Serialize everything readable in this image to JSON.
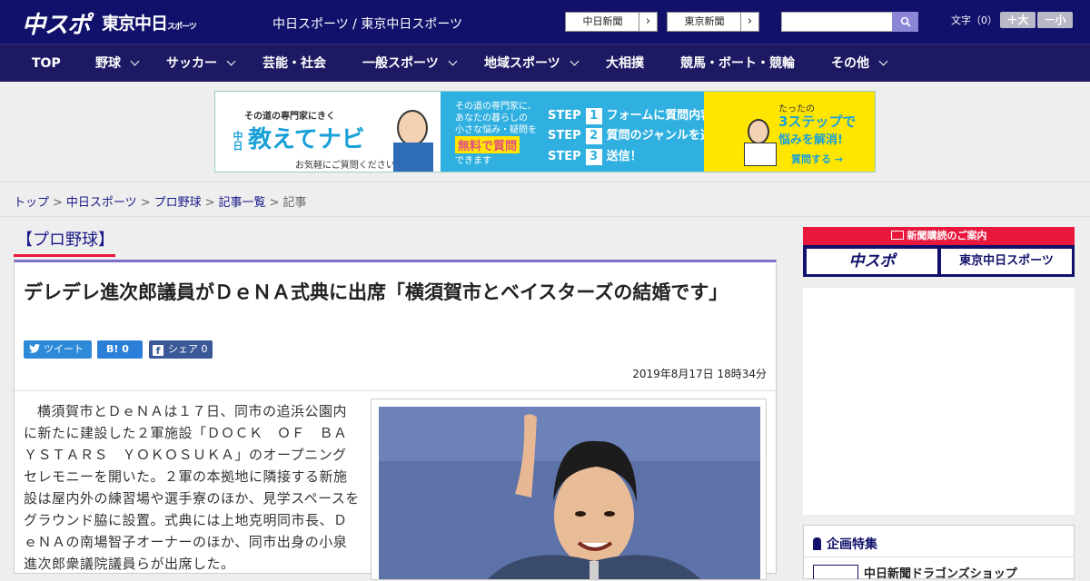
{
  "header": {
    "logo_chuspo": "中スポ",
    "logo_tokyo": "東京中日",
    "logo_tokyo_sub": "スポーツ",
    "site_title": "中日スポーツ / 東京中日スポーツ",
    "ext_links": [
      {
        "label": "中日新聞",
        "arrow": "›"
      },
      {
        "label": "東京新聞",
        "arrow": "›"
      }
    ],
    "search_placeholder": "",
    "font_size_label": "文字（0）",
    "font_larger": "＋大",
    "font_smaller": "－小"
  },
  "nav": {
    "items": [
      {
        "label": "TOP"
      },
      {
        "label": "野球"
      },
      {
        "label": "サッカー"
      },
      {
        "label": "芸能・社会"
      },
      {
        "label": "一般スポーツ"
      },
      {
        "label": "地域スポーツ"
      },
      {
        "label": "大相撲"
      },
      {
        "label": "競馬・ボート・競輪"
      },
      {
        "label": "その他"
      }
    ]
  },
  "ad_banner": {
    "tagline": "その道の専門家にきく",
    "brand_prefix": "中日",
    "brand": "教えてナビ",
    "note": "お気軽にご質問ください!",
    "mid_line1": "その道の専門家に、",
    "mid_line2": "あなたの暮らしの",
    "mid_line3": "小さな悩み・疑問を",
    "mid_badge": "無料で質問",
    "mid_line4": "できます",
    "steps": [
      {
        "prefix": "STEP",
        "num": "1",
        "text": "フォームに質問内容を入力"
      },
      {
        "prefix": "STEP",
        "num": "2",
        "text": "質問のジャンルを選択"
      },
      {
        "prefix": "STEP",
        "num": "3",
        "text": "送信！"
      }
    ],
    "right_small": "たったの",
    "right_big": "3ステップで",
    "right_sub": "悩みを解消!",
    "right_link": "質問する →"
  },
  "breadcrumb": {
    "items": [
      "トップ",
      "中日スポーツ",
      "プロ野球",
      "記事一覧"
    ],
    "current": "記事",
    "sep": ">"
  },
  "article": {
    "category": "【プロ野球】",
    "title": "デレデレ進次郎議員がＤｅＮＡ式典に出席「横須賀市とベイスターズの結婚です」",
    "share_tweet": "ツイート",
    "share_hatena": "B! 0",
    "share_fb": "シェア 0",
    "date": "2019年8月17日 18時34分",
    "body": "横須賀市とＤｅＮＡは１７日、同市の追浜公園内に新たに建設した２軍施設「ＤＯＣＫ　ＯＦ　ＢＡＹＳＴＡＲＳ　ＹＯＫＯＳＵＫＡ」のオープニングセレモニーを開いた。２軍の本拠地に隣接する新施設は屋内外の練習場や選手寮のほか、見学スペースをグラウンド脇に設置。式典には上地克明同市長、ＤｅＮＡの南場智子オーナーのほか、同市出身の小泉進次郎衆議院議員らが出席した。"
  },
  "sidebar": {
    "subscribe_head": "新聞購読のご案内",
    "subscribe_logo1": "中スポ",
    "subscribe_logo2": "東京中日スポーツ",
    "feature_head": "企画特集",
    "feature_item": "中日新聞ドラゴンズショップ"
  },
  "colors": {
    "header_bg": "#11116b",
    "nav_bg": "#1d1a63",
    "accent_purple": "#7a72c8",
    "subscribe_red": "#e8173c",
    "link_blue": "#1a1a8a"
  }
}
